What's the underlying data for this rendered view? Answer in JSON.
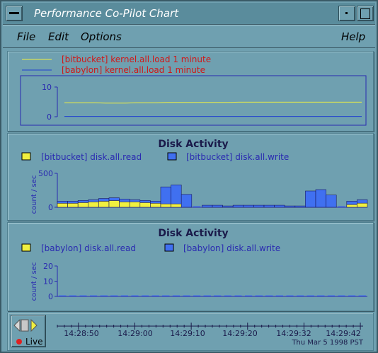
{
  "window": {
    "title": "Performance Co-Pilot Chart"
  },
  "menu": {
    "file": "File",
    "edit": "Edit",
    "options": "Options",
    "help": "Help"
  },
  "colors": {
    "background": "#6fa0b0",
    "plot_border": "#2a2ab0",
    "label_red": "#d01818",
    "series_yellow": "#f0f040",
    "series_blue": "#4070f0"
  },
  "load_chart": {
    "legend": [
      {
        "name": "[bitbucket] kernel.all.load 1 minute",
        "color": "#f0f040"
      },
      {
        "name": "[babylon] kernel.all.load 1 minute",
        "color": "#2040d0"
      }
    ]
  },
  "disk1": {
    "title": "Disk Activity",
    "read_label": "[bitbucket] disk.all.read",
    "write_label": "[bitbucket] disk.all.write",
    "ylabel": "count / sec"
  },
  "disk2": {
    "title": "Disk Activity",
    "read_label": "[babylon] disk.all.read",
    "write_label": "[babylon] disk.all.write",
    "ylabel": "count / sec"
  },
  "chart_data": [
    {
      "type": "line",
      "title": "",
      "ylim": [
        0,
        10
      ],
      "yticks": [
        "10",
        "0"
      ],
      "series": [
        {
          "name": "[bitbucket] kernel.all.load 1 minute",
          "color": "#f0f040",
          "values": [
            4.7,
            4.7,
            4.7,
            4.7,
            4.6,
            4.6,
            4.6,
            4.7,
            4.7,
            4.7,
            4.8,
            4.8,
            4.8,
            4.8,
            4.8,
            4.8,
            4.8,
            4.9,
            4.9,
            4.9,
            4.9,
            4.9,
            4.9,
            4.9,
            4.9,
            4.9,
            4.9,
            4.9,
            4.9,
            4.9
          ]
        },
        {
          "name": "[babylon] kernel.all.load 1 minute",
          "color": "#2040d0",
          "values": [
            0.1,
            0.1,
            0.1,
            0.1,
            0.1,
            0.1,
            0.1,
            0.1,
            0.1,
            0.1,
            0.1,
            0.1,
            0.1,
            0.1,
            0.1,
            0.1,
            0.1,
            0.1,
            0.1,
            0.1,
            0.1,
            0.1,
            0.1,
            0.1,
            0.1,
            0.1,
            0.1,
            0.1,
            0.1,
            0.1
          ]
        }
      ]
    },
    {
      "type": "bar",
      "stacked": true,
      "title": "Disk Activity",
      "ylabel": "count / sec",
      "ylim": [
        0,
        500
      ],
      "yticks": [
        "500",
        "0"
      ],
      "series": [
        {
          "name": "[bitbucket] disk.all.read",
          "color": "#f0f040",
          "values": [
            60,
            60,
            70,
            80,
            90,
            100,
            80,
            80,
            70,
            60,
            50,
            50,
            0,
            0,
            0,
            0,
            0,
            0,
            0,
            0,
            0,
            0,
            0,
            0,
            0,
            0,
            0,
            0,
            40,
            60
          ]
        },
        {
          "name": "[bitbucket] disk.all.write",
          "color": "#4070f0",
          "values": [
            30,
            30,
            30,
            30,
            40,
            40,
            40,
            30,
            30,
            30,
            250,
            280,
            190,
            0,
            30,
            30,
            20,
            30,
            30,
            30,
            30,
            30,
            20,
            20,
            240,
            260,
            180,
            0,
            50,
            50
          ]
        }
      ]
    },
    {
      "type": "bar",
      "stacked": true,
      "title": "Disk Activity",
      "ylabel": "count / sec",
      "ylim": [
        0,
        20
      ],
      "yticks": [
        "20",
        "10",
        "0"
      ],
      "series": [
        {
          "name": "[babylon] disk.all.read",
          "color": "#f0f040",
          "values": [
            0,
            0,
            0,
            0,
            0,
            0,
            0,
            0,
            0,
            0,
            0,
            0,
            0,
            0,
            0,
            0,
            0,
            0,
            0,
            0,
            0,
            0,
            0,
            0,
            0,
            0,
            0,
            0,
            0,
            0
          ]
        },
        {
          "name": "[babylon] disk.all.write",
          "color": "#4070f0",
          "values": [
            0,
            0,
            0,
            0,
            0,
            0,
            0,
            0,
            0,
            0,
            0,
            0,
            0,
            0,
            0,
            0,
            0,
            0,
            0,
            0,
            0,
            0,
            0,
            0,
            0,
            0,
            0,
            0,
            0,
            0
          ]
        }
      ]
    }
  ],
  "time": {
    "ticks": [
      "14:28:50",
      "14:29:00",
      "14:29:10",
      "14:29:20",
      "14:29:32",
      "14:29:42"
    ],
    "date": "Thu Mar  5 1998 PST",
    "live_label": "Live"
  }
}
